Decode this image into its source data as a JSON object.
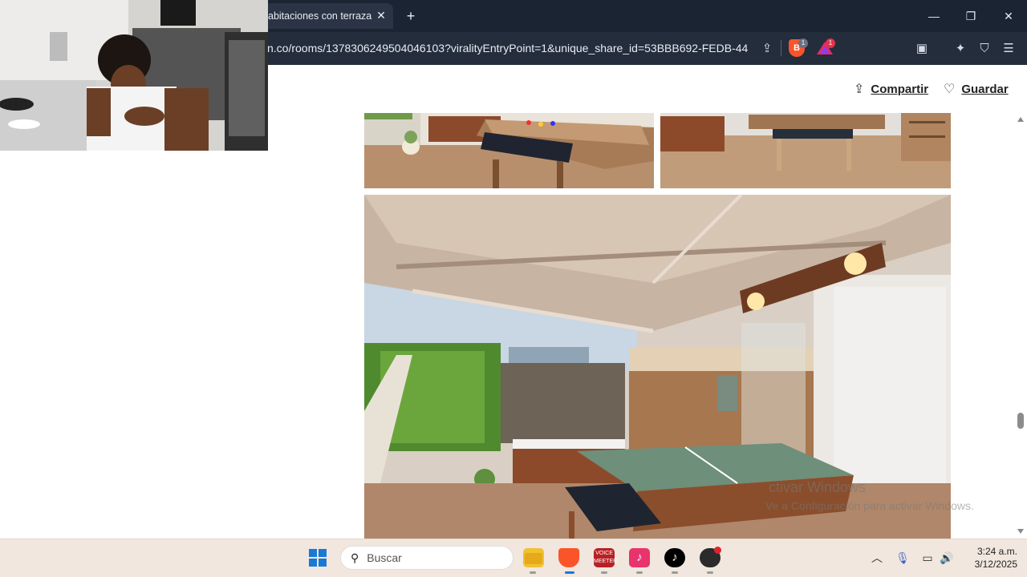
{
  "browser": {
    "tab_title": "abitaciones con terraza",
    "url": "n.co/rooms/1378306249504046103?viralityEntryPoint=1&unique_share_id=53BBB692-FEDB-44...",
    "shields_count": "1",
    "rewards_count": "1",
    "accent": "#fb542b"
  },
  "page": {
    "share_label": "Compartir",
    "save_label": "Guardar",
    "watermark_line1": "ctivar Windows",
    "watermark_line2": "Ve a Configuración para activar Windows."
  },
  "taskbar": {
    "search_placeholder": "Buscar",
    "voicemeeter_label": "VOICE\nMEETER",
    "clock_time": "3:24 a.m.",
    "clock_date": "3/12/2025"
  }
}
